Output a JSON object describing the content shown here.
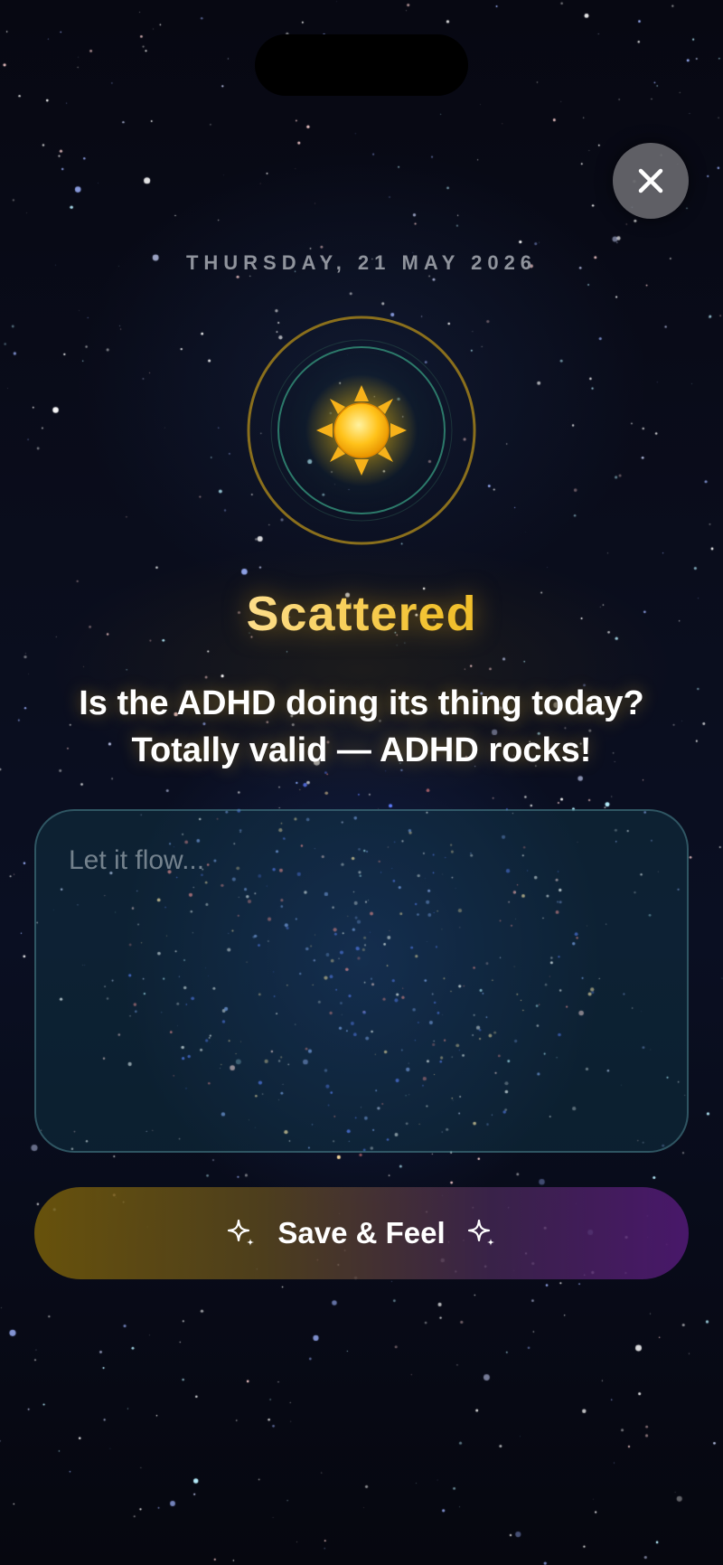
{
  "close_button": {
    "icon": "close-icon"
  },
  "date_label": "THURSDAY, 21 MAY 2026",
  "mood": {
    "icon": "sun-icon",
    "title": "Scattered",
    "accent_color": "#f2c230",
    "message_line1": "Is the ADHD doing its thing today?",
    "message_line2": "Totally valid — ADHD rocks!"
  },
  "journal": {
    "placeholder": "Let it flow...",
    "value": ""
  },
  "save_button": {
    "label": "Save & Feel",
    "icon": "sparkle-icon"
  }
}
